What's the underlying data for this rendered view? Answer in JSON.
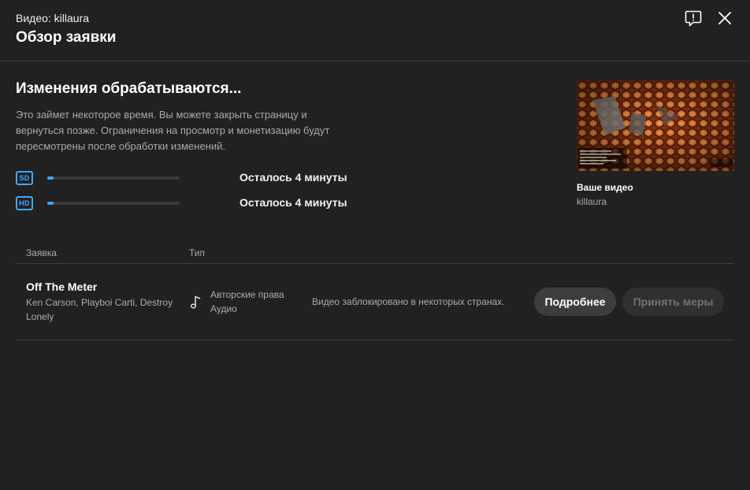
{
  "header": {
    "video_label": "Видео: killaura",
    "title": "Обзор заявки",
    "feedback_icon": "feedback-icon",
    "close_icon": "close-icon"
  },
  "status": {
    "title": "Изменения обрабатываются...",
    "description": "Это займет некоторое время. Вы можете закрыть страницу и вернуться позже. Ограничения на просмотр и монетизацию будут пересмотрены после обработки изменений.",
    "rows": [
      {
        "badge": "SD",
        "progress": 0.05,
        "remaining": "Осталось 4 минуты"
      },
      {
        "badge": "HD",
        "progress": 0.05,
        "remaining": "Осталось 4 минуты"
      }
    ]
  },
  "video": {
    "label": "Ваше видео",
    "channel": "killaura"
  },
  "table": {
    "headers": [
      "Заявка",
      "Тип"
    ],
    "rows": [
      {
        "title": "Off The Meter",
        "artists": "Ken Carson, Playboi Carti, Destroy Lonely",
        "type_icon": "music-note-icon",
        "type": "Авторские права",
        "subtype": "Аудио",
        "impact": "Видео заблокировано в некоторых странах.",
        "details_button": "Подробнее",
        "action_button": "Принять меры"
      }
    ]
  },
  "colors": {
    "background": "#212121",
    "accent": "#3ea6ff",
    "secondary_text": "#aaaaaa"
  }
}
